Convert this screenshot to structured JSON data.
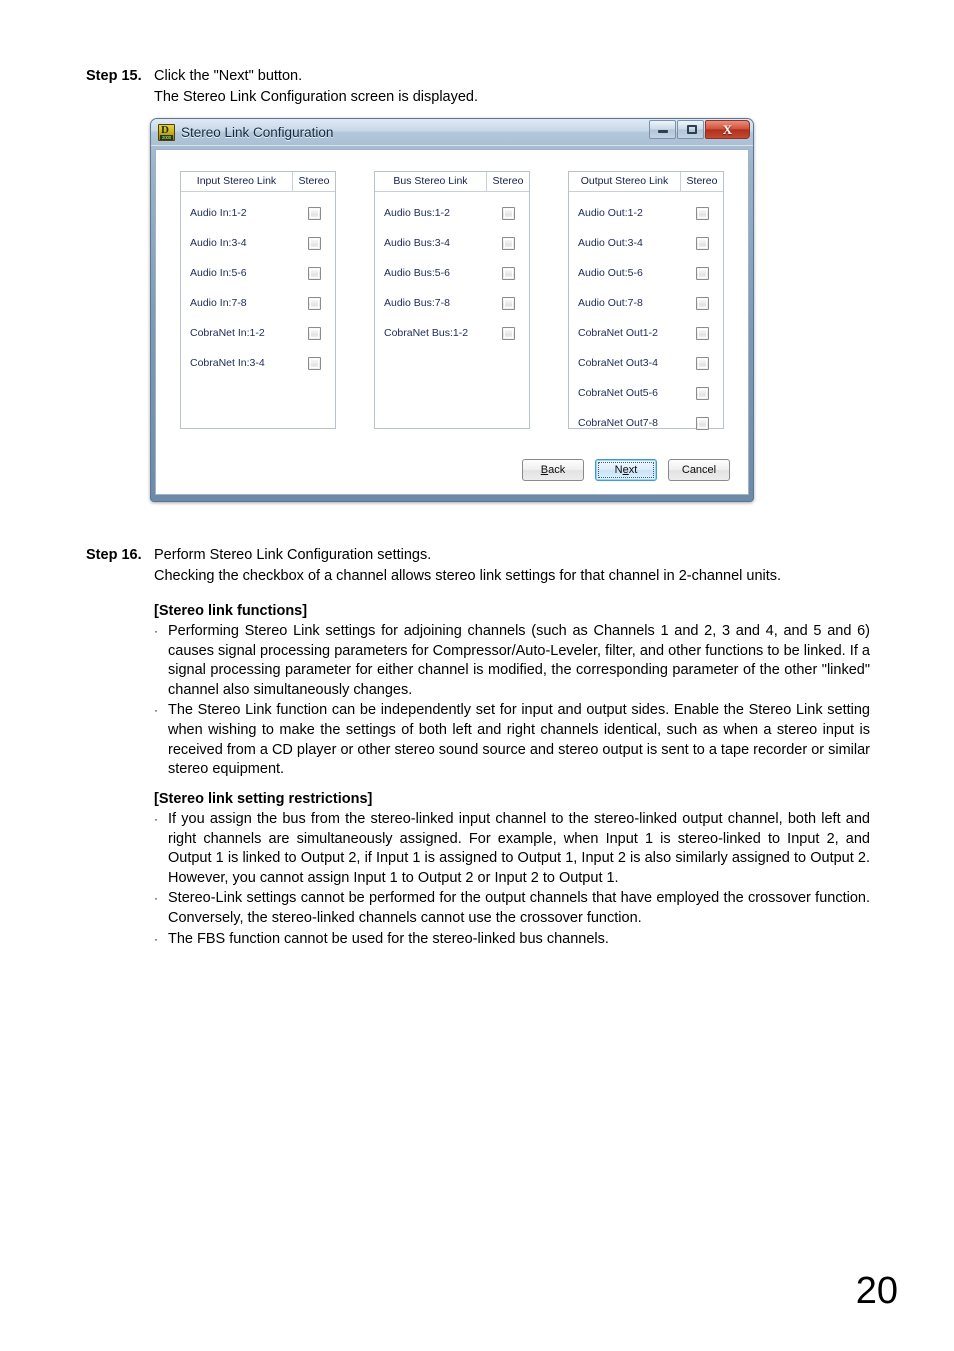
{
  "page": {
    "number": "20"
  },
  "step15": {
    "label": "Step 15.",
    "lines": [
      "Click the \"Next\" button.",
      "The Stereo Link Configuration screen is displayed."
    ]
  },
  "step16": {
    "label": "Step 16.",
    "lines": [
      "Perform Stereo Link Configuration settings.",
      "Checking the checkbox of a channel allows stereo link settings for that channel in 2-channel units."
    ]
  },
  "sections": [
    {
      "heading": "[Stereo link functions]",
      "bullets": [
        "Performing Stereo Link settings for adjoining channels (such as Channels 1 and 2, 3 and 4, and 5 and 6) causes signal processing parameters for Compressor/Auto-Leveler, filter, and other functions to be linked. If a signal processing parameter for either channel is modified, the corresponding parameter of the other \"linked\" channel also simultaneously changes.",
        "The Stereo Link function can be independently set for input and output sides. Enable the Stereo Link setting when wishing to make the settings of both left and right channels identical, such as when a stereo input is received from a CD player or other stereo sound source and stereo output is sent to a tape recorder or similar stereo equipment."
      ]
    },
    {
      "heading": "[Stereo link setting restrictions]",
      "bullets": [
        "If you assign the bus from the stereo-linked input channel to the stereo-linked output channel, both left and right channels are simultaneously assigned. For example, when Input 1 is stereo-linked to Input 2, and Output 1 is linked to Output 2, if Input 1 is assigned to Output 1, Input 2 is also similarly assigned to Output 2. However, you cannot assign Input 1 to Output 2 or Input 2 to Output 1.",
        "Stereo-Link settings cannot be performed for the output channels that have employed the crossover function. Conversely, the stereo-linked channels cannot use the crossover function.",
        "The FBS function cannot be used for the stereo-linked bus channels."
      ]
    }
  ],
  "dialog": {
    "title": "Stereo Link Configuration",
    "icon": {
      "letter": "D",
      "number": "2000"
    },
    "window_controls": [
      {
        "name": "minimize",
        "glyph": "–"
      },
      {
        "name": "maximize",
        "glyph": "□"
      },
      {
        "name": "close",
        "glyph": "X"
      }
    ],
    "panels": [
      {
        "title": "Input Stereo Link",
        "stereo_header": "Stereo",
        "rows": [
          {
            "label": "Audio In:1-2",
            "checked": false
          },
          {
            "label": "Audio In:3-4",
            "checked": false
          },
          {
            "label": "Audio In:5-6",
            "checked": false
          },
          {
            "label": "Audio In:7-8",
            "checked": false
          },
          {
            "label": "CobraNet In:1-2",
            "checked": false
          },
          {
            "label": "CobraNet In:3-4",
            "checked": false
          }
        ]
      },
      {
        "title": "Bus Stereo Link",
        "stereo_header": "Stereo",
        "rows": [
          {
            "label": "Audio Bus:1-2",
            "checked": false
          },
          {
            "label": "Audio Bus:3-4",
            "checked": false
          },
          {
            "label": "Audio Bus:5-6",
            "checked": false
          },
          {
            "label": "Audio Bus:7-8",
            "checked": false
          },
          {
            "label": "CobraNet Bus:1-2",
            "checked": false
          }
        ]
      },
      {
        "title": "Output Stereo Link",
        "stereo_header": "Stereo",
        "rows": [
          {
            "label": "Audio Out:1-2",
            "checked": false
          },
          {
            "label": "Audio Out:3-4",
            "checked": false
          },
          {
            "label": "Audio Out:5-6",
            "checked": false
          },
          {
            "label": "Audio Out:7-8",
            "checked": false
          },
          {
            "label": "CobraNet Out1-2",
            "checked": false
          },
          {
            "label": "CobraNet Out3-4",
            "checked": false
          },
          {
            "label": "CobraNet Out5-6",
            "checked": false
          },
          {
            "label": "CobraNet Out7-8",
            "checked": false
          }
        ]
      }
    ],
    "buttons": [
      {
        "name": "back",
        "label": "Back",
        "accel_index": 0,
        "focused": false
      },
      {
        "name": "next",
        "label": "Next",
        "accel_index": 1,
        "focused": true
      },
      {
        "name": "cancel",
        "label": "Cancel",
        "accel_index": -1,
        "focused": false
      }
    ]
  },
  "colors": {
    "title_text": "#122b44",
    "panel_text": "#1c2a58",
    "focus_accent": "#3c9ad6",
    "close_button": "#b03020",
    "icon_yellow": "#c9ab15"
  }
}
